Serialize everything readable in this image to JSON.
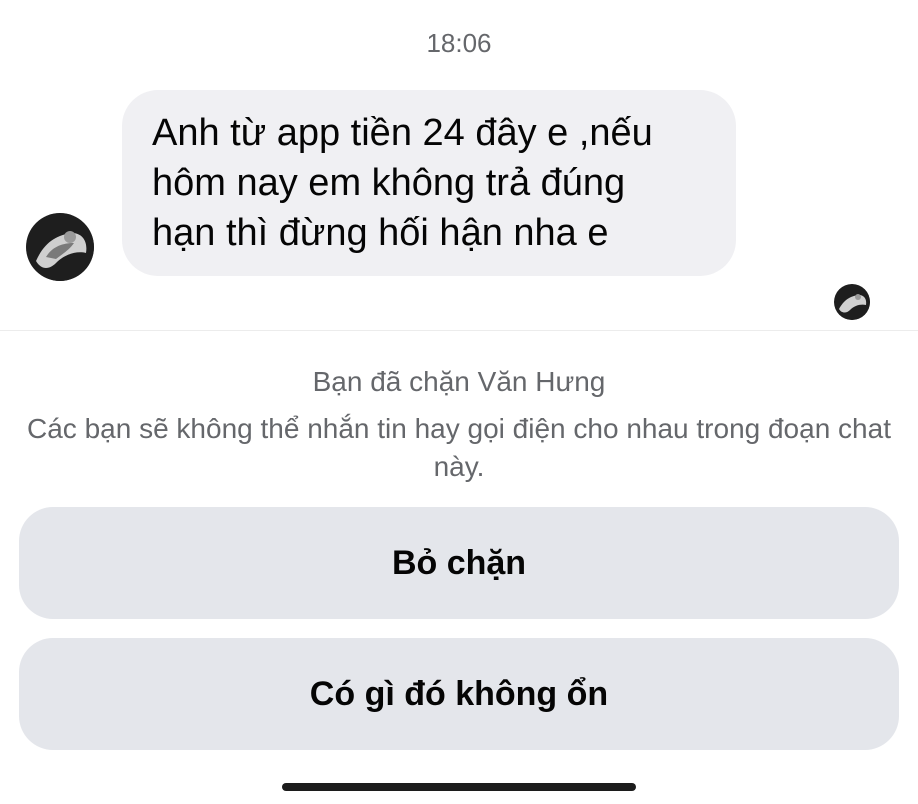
{
  "thread": {
    "timestamp": "18:06",
    "message": {
      "text": "Anh từ app tiền 24 đây e ,nếu\nhôm nay em không trả đúng\nhạn thì đừng hối hận nha e"
    },
    "sender_avatar_icon": "profile-photo",
    "seen_avatar_icon": "profile-photo"
  },
  "blocked_notice": {
    "title": "Bạn đã chặn Văn Hưng",
    "description": "Các bạn sẽ không thể nhắn tin hay gọi điện cho nhau trong đoạn chat này."
  },
  "actions": {
    "unblock_label": "Bỏ chặn",
    "report_label": "Có gì đó không ổn"
  },
  "colors": {
    "bubble_bg": "#f0f0f3",
    "button_bg": "#e4e6eb",
    "secondary_text": "#65676b"
  }
}
